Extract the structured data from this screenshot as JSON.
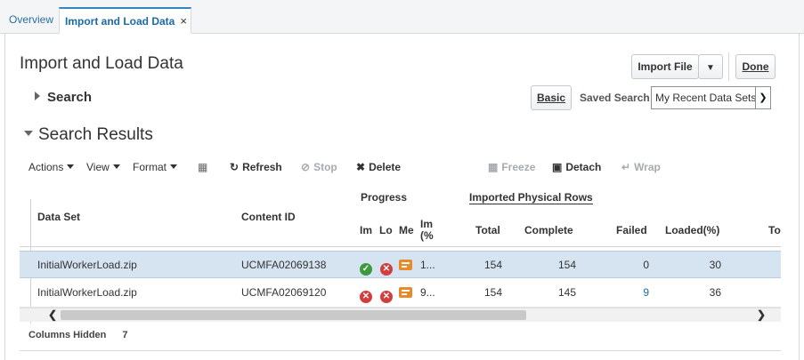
{
  "tabs": [
    {
      "label": "Overview"
    },
    {
      "label": "Import and Load Data",
      "close": "×"
    }
  ],
  "page": {
    "title": "Import and Load Data",
    "import_file_label": "Import File",
    "done_label": "Done"
  },
  "search": {
    "heading": "Search",
    "basic_label": "Basic",
    "saved_search_label": "Saved Search",
    "saved_search_value": "My Recent Data Sets"
  },
  "results": {
    "heading": "Search Results",
    "toolbar": {
      "actions": "Actions",
      "view": "View",
      "format": "Format",
      "refresh": "Refresh",
      "stop": "Stop",
      "delete": "Delete",
      "freeze": "Freeze",
      "detach": "Detach",
      "wrap": "Wrap"
    },
    "group_headers": {
      "progress": "Progress",
      "imported_physical_rows": "Imported Physical Rows"
    },
    "columns": {
      "data_set": "Data Set",
      "content_id": "Content ID",
      "import_status": "Im",
      "load_status": "Lo",
      "messages": "Me",
      "import_pct": "Im",
      "import_pct_2": "(%",
      "total": "Total",
      "complete": "Complete",
      "failed": "Failed",
      "loaded_pct": "Loaded(%)",
      "to": "To"
    },
    "rows": [
      {
        "data_set": "InitialWorkerLoad.zip",
        "content_id": "UCMFA02069138",
        "pct": "1...",
        "total": "154",
        "complete": "154",
        "failed": "0",
        "loaded": "30",
        "import_icon": "check-icon",
        "load_icon": "error-icon"
      },
      {
        "data_set": "InitialWorkerLoad.zip",
        "content_id": "UCMFA02069120",
        "pct": "9...",
        "total": "154",
        "complete": "145",
        "failed": "9",
        "loaded": "36",
        "import_icon": "error-icon",
        "load_icon": "error-icon"
      }
    ],
    "columns_hidden_label": "Columns Hidden",
    "columns_hidden_count": "7"
  },
  "colors": {
    "accent": "#1b6aa5",
    "selected_row": "#d6e4f2",
    "ok": "#3c9a3c",
    "error": "#d23d3d",
    "message": "#e98a2a"
  }
}
